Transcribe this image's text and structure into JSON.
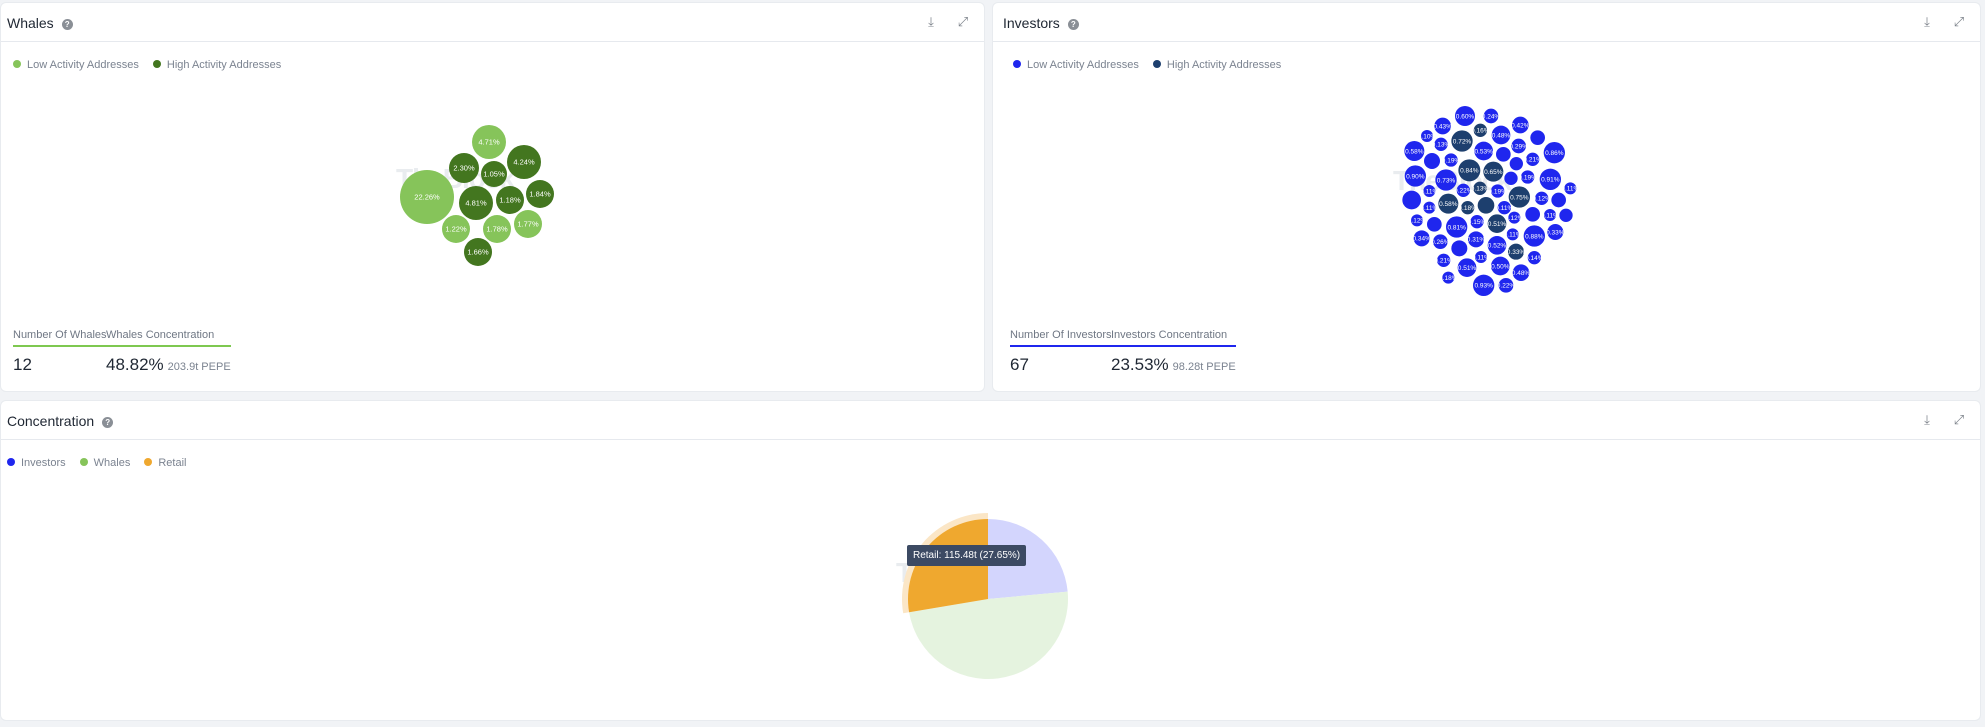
{
  "whales": {
    "title": "Whales",
    "legend": [
      "Low Activity Addresses",
      "High Activity Addresses"
    ],
    "colors": {
      "low": "#86c45a",
      "high": "#43761f"
    },
    "bubbles": [
      {
        "v": "22.26%",
        "t": "low"
      },
      {
        "v": "4.71%",
        "t": "low"
      },
      {
        "v": "2.30%",
        "t": "high"
      },
      {
        "v": "1.05%",
        "t": "high"
      },
      {
        "v": "4.24%",
        "t": "high"
      },
      {
        "v": "4.81%",
        "t": "high"
      },
      {
        "v": "1.18%",
        "t": "high"
      },
      {
        "v": "1.84%",
        "t": "high"
      },
      {
        "v": "1.22%",
        "t": "low"
      },
      {
        "v": "1.78%",
        "t": "low"
      },
      {
        "v": "1.77%",
        "t": "low"
      },
      {
        "v": "1.66%",
        "t": "high"
      }
    ],
    "count_label": "Number Of Whales",
    "count": "12",
    "conc_label": "Whales Concentration",
    "conc": "48.82%",
    "conc_sub": "203.9t PEPE"
  },
  "investors": {
    "title": "Investors",
    "legend": [
      "Low Activity Addresses",
      "High Activity Addresses"
    ],
    "colors": {
      "low": "#1f26ee",
      "high": "#1d3f6e"
    },
    "bubbles": [
      "0.60%|l",
      "0.24%|l",
      "0.43%|l",
      "0.16%|h",
      "0.48%|l",
      "0.42%|l",
      "0.10%|l",
      "0.72%|h",
      "0.13%|l",
      "|l",
      "0.58%|l",
      "0.53%|l",
      "0.29%|l",
      "0.86%|l",
      "|l",
      "0.19%|l",
      "|l",
      "|l",
      "0.21%|l",
      "0.90%|l",
      "0.84%|h",
      "0.65%|h",
      "0.73%|l",
      "|l",
      "0.19%|l",
      "0.91%|l",
      "0.11%|l",
      "0.11%|l",
      "0.22%|l",
      "0.13%|h",
      "0.19%|l",
      "0.75%|h",
      "|l",
      "0.58%|h",
      "0.18%|h",
      "|h",
      "0.11%|l",
      "0.12%|l",
      "|l",
      "0.11%|l",
      "0.12%|l",
      "|l",
      "0.81%|l",
      "0.15%|l",
      "0.51%|h",
      "0.12%|l",
      "|l",
      "0.11%|l",
      "|l",
      "0.34%|l",
      "0.26%|l",
      "0.31%|l",
      "|l",
      "0.52%|l",
      "0.11%|l",
      "0.88%|l",
      "0.33%|l",
      "0.33%|h",
      "0.21%|l",
      "0.11%|l",
      "0.14%|l",
      "0.51%|l",
      "0.50%|l",
      "0.48%|l",
      "0.18%|l",
      "0.93%|l",
      "0.22%|l"
    ],
    "count_label": "Number Of Investors",
    "count": "67",
    "conc_label": "Investors Concentration",
    "conc": "23.53%",
    "conc_sub": "98.28t PEPE"
  },
  "concentration": {
    "title": "Concentration",
    "legend": [
      "Investors",
      "Whales",
      "Retail"
    ],
    "colors": {
      "investors": "#1f26ee",
      "whales": "#86c45a",
      "retail": "#efa82f"
    },
    "tooltip": "Retail: 115.48t (27.65%)"
  },
  "chart_data": {
    "type": "pie",
    "categories": [
      "Investors",
      "Whales",
      "Retail"
    ],
    "values": [
      23.53,
      48.82,
      27.65
    ],
    "highlighted": "Retail"
  },
  "watermark": "TheBlock"
}
